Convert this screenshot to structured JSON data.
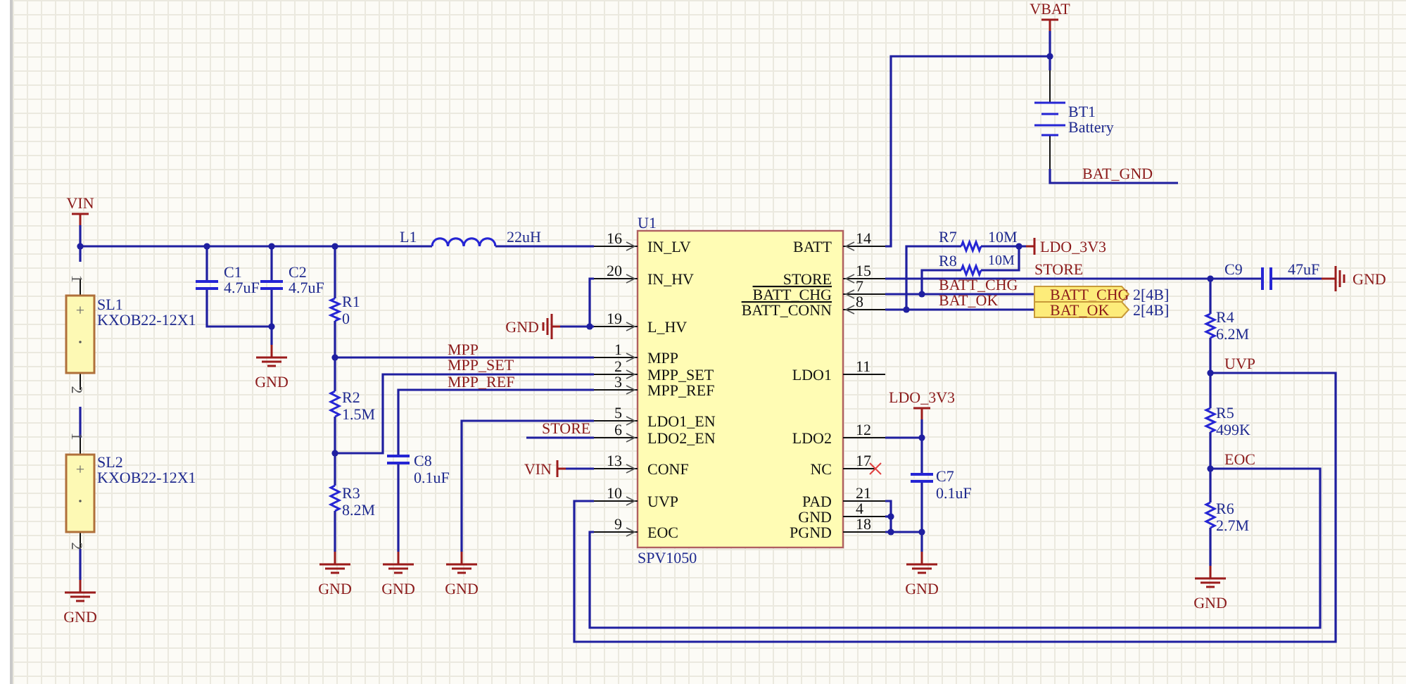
{
  "schematic": {
    "chip": {
      "designator": "U1",
      "part_number": "SPV1050",
      "left_pins": [
        {
          "number": "16",
          "name": "IN_LV"
        },
        {
          "number": "20",
          "name": "IN_HV"
        },
        {
          "number": "19",
          "name": "L_HV"
        },
        {
          "number": "1",
          "name": "MPP"
        },
        {
          "number": "2",
          "name": "MPP_SET"
        },
        {
          "number": "3",
          "name": "MPP_REF"
        },
        {
          "number": "5",
          "name": "LDO1_EN"
        },
        {
          "number": "6",
          "name": "LDO2_EN"
        },
        {
          "number": "13",
          "name": "CONF"
        },
        {
          "number": "10",
          "name": "UVP"
        },
        {
          "number": "9",
          "name": "EOC"
        }
      ],
      "right_pins": [
        {
          "number": "14",
          "name": "BATT",
          "active_low": false
        },
        {
          "number": "15",
          "name": "STORE",
          "active_low": false
        },
        {
          "number": "7",
          "name": "BATT_CHG",
          "active_low": true
        },
        {
          "number": "8",
          "name": "BATT_CONN",
          "active_low": true
        },
        {
          "number": "11",
          "name": "LDO1",
          "active_low": false
        },
        {
          "number": "12",
          "name": "LDO2",
          "active_low": false
        },
        {
          "number": "17",
          "name": "NC",
          "active_low": false
        },
        {
          "number": "21",
          "name": "PAD",
          "active_low": false
        },
        {
          "number": "4",
          "name": "GND",
          "active_low": false
        },
        {
          "number": "18",
          "name": "PGND",
          "active_low": false
        }
      ]
    },
    "components": [
      {
        "kind": "solar_cell",
        "designator": "SL1",
        "value": "KXOB22-12X1",
        "pin_1": "1",
        "pin_2": "2",
        "polarity": "+"
      },
      {
        "kind": "solar_cell",
        "designator": "SL2",
        "value": "KXOB22-12X1",
        "pin_1": "1",
        "pin_2": "2",
        "polarity": "+"
      },
      {
        "kind": "capacitor",
        "designator": "C1",
        "value": "4.7uF"
      },
      {
        "kind": "capacitor",
        "designator": "C2",
        "value": "4.7uF"
      },
      {
        "kind": "resistor",
        "designator": "R1",
        "value": "0"
      },
      {
        "kind": "resistor",
        "designator": "R2",
        "value": "1.5M"
      },
      {
        "kind": "resistor",
        "designator": "R3",
        "value": "8.2M"
      },
      {
        "kind": "capacitor",
        "designator": "C8",
        "value": "0.1uF"
      },
      {
        "kind": "inductor",
        "designator": "L1",
        "value": "22uH"
      },
      {
        "kind": "battery",
        "designator": "BT1",
        "value": "Battery"
      },
      {
        "kind": "resistor",
        "designator": "R7",
        "value": "10M"
      },
      {
        "kind": "resistor",
        "designator": "R8",
        "value": "10M"
      },
      {
        "kind": "capacitor",
        "designator": "C9",
        "value": "47uF"
      },
      {
        "kind": "resistor",
        "designator": "R4",
        "value": "6.2M"
      },
      {
        "kind": "resistor",
        "designator": "R5",
        "value": "499K"
      },
      {
        "kind": "resistor",
        "designator": "R6",
        "value": "2.7M"
      },
      {
        "kind": "capacitor",
        "designator": "C7",
        "value": "0.1uF"
      }
    ],
    "power_ports": [
      {
        "kind": "bar",
        "label": "VIN"
      },
      {
        "kind": "ground",
        "label": "GND"
      },
      {
        "kind": "ground",
        "label": "GND"
      },
      {
        "kind": "ground",
        "label": "GND"
      },
      {
        "kind": "ground",
        "label": "GND"
      },
      {
        "kind": "ground",
        "label": "GND"
      },
      {
        "kind": "ground",
        "label": "GND"
      },
      {
        "kind": "bar",
        "label": "VIN"
      },
      {
        "kind": "bar",
        "label": "VBAT"
      },
      {
        "kind": "bar",
        "label": "LDO_3V3"
      },
      {
        "kind": "ground",
        "label": "GND"
      },
      {
        "kind": "bar",
        "label": "LDO_3V3"
      },
      {
        "kind": "ground",
        "label": "GND"
      },
      {
        "kind": "ground",
        "label": "GND"
      }
    ],
    "net_labels": [
      "MPP",
      "MPP_SET",
      "MPP_REF",
      "STORE",
      "BAT_GND",
      "STORE",
      "BATT_CHG",
      "BAT_OK",
      "UVP",
      "EOC"
    ],
    "ports": [
      {
        "label": "BATT_CHG",
        "reference": "2[4B]"
      },
      {
        "label": "BAT_OK",
        "reference": "2[4B]"
      }
    ]
  }
}
